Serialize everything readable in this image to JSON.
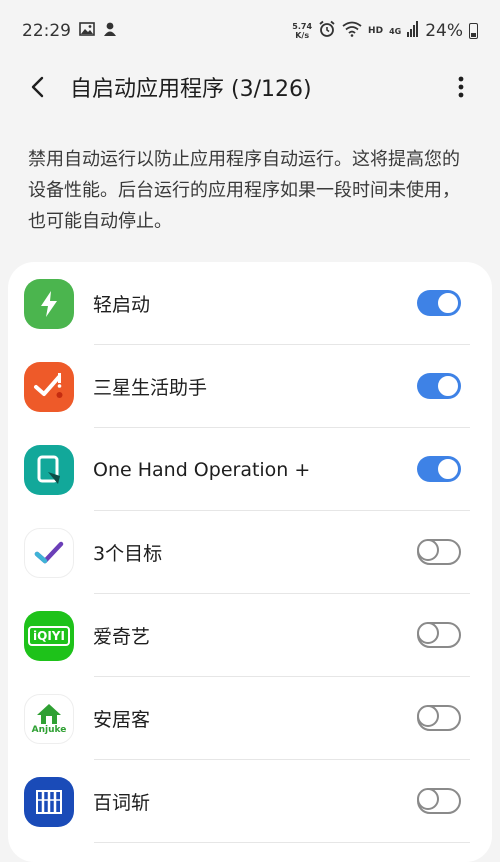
{
  "status_bar": {
    "time": "22:29",
    "speed_value": "5.74",
    "speed_unit": "K/s",
    "network_label": "HD",
    "network_type": "4G",
    "battery": "24%"
  },
  "header": {
    "title": "自启动应用程序 (3/126)"
  },
  "description": "禁用自动运行以防止应用程序自动运行。这将提高您的设备性能。后台运行的应用程序如果一段时间未使用，也可能自动停止。",
  "apps": [
    {
      "name": "轻启动",
      "icon": "lightning-icon",
      "color": "#4bb54e",
      "enabled": true
    },
    {
      "name": "三星生活助手",
      "icon": "check-alert-icon",
      "color": "#ee5a29",
      "enabled": true
    },
    {
      "name": "One Hand Operation +",
      "icon": "one-hand-icon",
      "color": "#12a89a",
      "enabled": true
    },
    {
      "name": "3个目标",
      "icon": "checkmark-icon",
      "color": "#ffffff",
      "enabled": false
    },
    {
      "name": "爱奇艺",
      "icon": "iqiyi-icon",
      "color": "#1ec21a",
      "enabled": false
    },
    {
      "name": "安居客",
      "icon": "anjuke-icon",
      "color": "#ffffff",
      "icon_text": "Anjuke",
      "enabled": false
    },
    {
      "name": "百词斩",
      "icon": "baicizhan-icon",
      "color": "#1a4bb8",
      "enabled": false
    }
  ],
  "iqiyi_logo_text": "iQIYI",
  "accent_color": "#3e82e6"
}
